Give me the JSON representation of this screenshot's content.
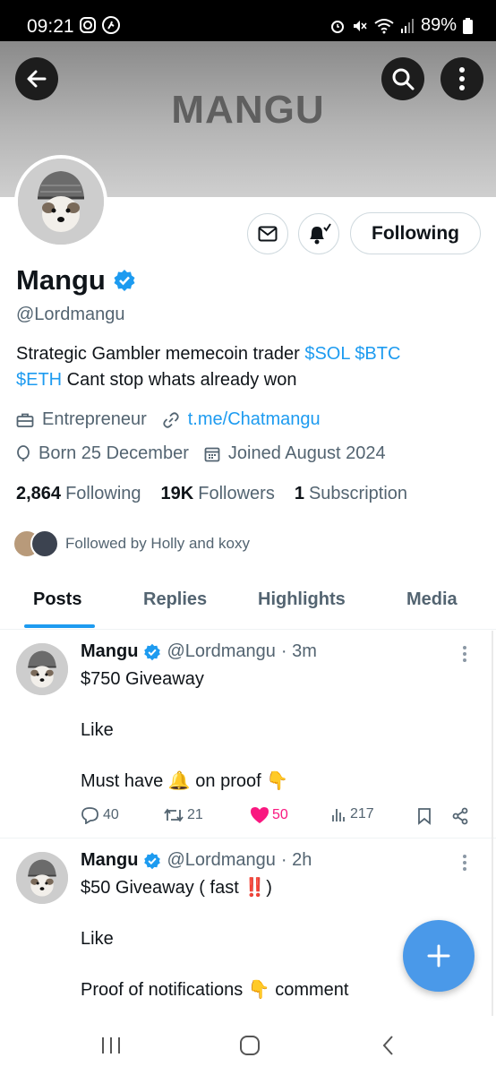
{
  "status_bar": {
    "time": "09:21",
    "battery": "89%",
    "left_icons": [
      "instagram-icon",
      "running-icon"
    ],
    "right_icons": [
      "alarm-icon",
      "mute-icon",
      "wifi-icon",
      "signal-icon",
      "battery-icon"
    ]
  },
  "banner": {
    "text": "MANGU"
  },
  "profile": {
    "name": "Mangu",
    "handle": "@Lordmangu",
    "bio_parts": [
      "Strategic Gambler memecoin trader ",
      "$SOL",
      " ",
      "$BTC",
      "$ETH",
      " Cant stop whats already won"
    ],
    "category": "Entrepreneur",
    "link": "t.me/Chatmangu",
    "born": "Born 25 December",
    "joined": "Joined August 2024",
    "following_count": "2,864",
    "following_label": "Following",
    "followers_count": "19K",
    "followers_label": "Followers",
    "subscription_count": "1",
    "subscription_label": "Subscription",
    "followed_by": "Followed by Holly and koxy",
    "follow_button": "Following"
  },
  "tabs": [
    {
      "label": "Posts",
      "active": true
    },
    {
      "label": "Replies",
      "active": false
    },
    {
      "label": "Highlights",
      "active": false
    },
    {
      "label": "Media",
      "active": false
    }
  ],
  "posts": [
    {
      "name": "Mangu",
      "handle": "@Lordmangu",
      "time": "· 3m",
      "line1": "$750 Giveaway",
      "line2": "Like",
      "line3": "Must have 🔔 on proof 👇",
      "replies": "40",
      "reposts": "21",
      "likes": "50",
      "views": "217"
    },
    {
      "name": "Mangu",
      "handle": "@Lordmangu",
      "time": "· 2h",
      "line1": "$50 Giveaway ( fast ‼️)",
      "line2": "Like",
      "line3": "Proof of notifications 👇 comment"
    }
  ],
  "colors": {
    "accent": "#1d9bf0",
    "like": "#f91880",
    "fab": "#4a99e9",
    "secondary_text": "#536471"
  }
}
